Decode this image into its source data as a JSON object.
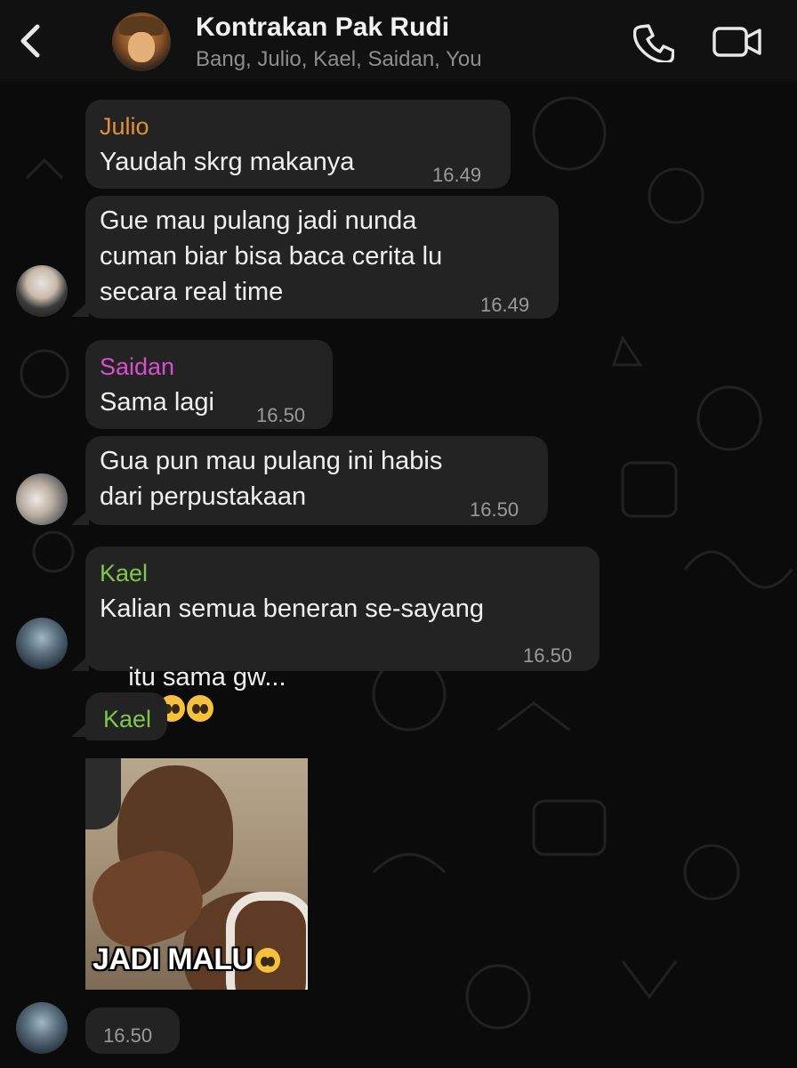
{
  "header": {
    "title": "Kontrakan Pak Rudi",
    "members": "Bang, Julio, Kael, Saidan, You"
  },
  "messages": [
    {
      "sender": "Julio",
      "sender_color": "#e0913a",
      "lines": [
        "Yaudah skrg makanya"
      ],
      "time": "16.49"
    },
    {
      "sender": "",
      "lines": [
        "Gue mau pulang jadi nunda",
        "cuman biar bisa baca cerita lu",
        "secara real time"
      ],
      "time": "16.49"
    },
    {
      "sender": "Saidan",
      "sender_color": "#d84fd0",
      "lines": [
        "Sama lagi"
      ],
      "time": "16.50"
    },
    {
      "sender": "",
      "lines": [
        "Gua pun mau pulang ini habis",
        "dari perpustakaan"
      ],
      "time": "16.50"
    },
    {
      "sender": "Kael",
      "sender_color": "#7fc84a",
      "lines": [
        "Kalian semua beneran se-sayang",
        "itu sama gw..."
      ],
      "emoji": "pleading-face",
      "emoji_count": 3,
      "time": "16.50"
    },
    {
      "sender": "Kael",
      "sender_color": "#7fc84a",
      "image_caption": "JADI MALU",
      "time": "16.50"
    }
  ],
  "icons": [
    "back-chevron-icon",
    "phone-icon",
    "video-camera-icon",
    "pleading-face-emoji",
    "laughing-emoji"
  ]
}
